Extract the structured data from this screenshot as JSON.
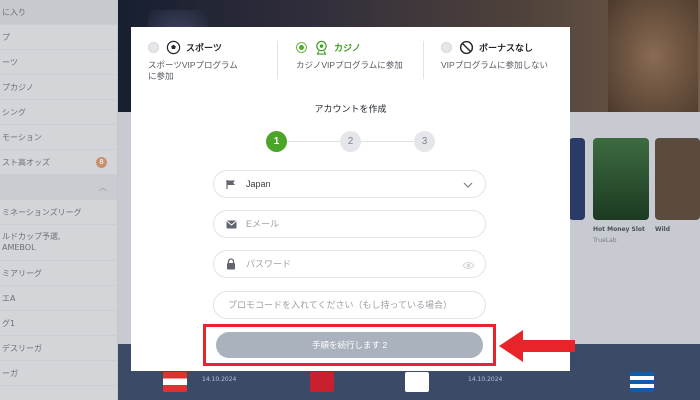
{
  "background": {
    "sidebar_items": [
      {
        "label": "に入り"
      },
      {
        "label": "プ"
      },
      {
        "label": "ーツ"
      },
      {
        "label": "プカジノ"
      },
      {
        "label": "シング"
      },
      {
        "label": "モーション"
      },
      {
        "label": "スト高オッズ",
        "badge": "8"
      },
      {
        "label": ""
      },
      {
        "label": "ミネーションズリーグ"
      },
      {
        "label": "ルドカップ予選,\nAMEBOL"
      },
      {
        "label": "ミアリーグ"
      },
      {
        "label": "エA"
      },
      {
        "label": "グ1"
      },
      {
        "label": "デスリーガ"
      },
      {
        "label": "ーガ"
      }
    ],
    "game_card_labels": {
      "card2_title": "Hot Money Slot",
      "card2_provider": "TrueLab",
      "card3_title": "Wild"
    },
    "match_dates": [
      "14.10.2024",
      "14.10.2024"
    ]
  },
  "modal": {
    "bonus_options": [
      {
        "title": "スポーツ",
        "desc": "スポーツVIPプログラムに参加",
        "icon": "soccer-ball-icon",
        "selected": false
      },
      {
        "title": "カジノ",
        "desc": "カジノVIPプログラムに参加",
        "icon": "roulette-icon",
        "selected": true
      },
      {
        "title": "ボーナスなし",
        "desc": "VIPプログラムに参加しない",
        "icon": "no-entry-icon",
        "selected": false
      }
    ],
    "title": "アカウントを作成",
    "steps": [
      "1",
      "2",
      "3"
    ],
    "active_step": 1,
    "country": {
      "value": "Japan",
      "icon": "flag-icon"
    },
    "email": {
      "placeholder": "Eメール",
      "icon": "envelope-icon"
    },
    "password": {
      "placeholder": "パスワード",
      "icon": "lock-icon"
    },
    "promo": {
      "placeholder": "プロモコードを入れてください（もし持っている場合）"
    },
    "continue_button": "手順を続行します 2"
  },
  "colors": {
    "accent_green": "#4aa528",
    "highlight_red": "#e8242a",
    "button_disabled": "#aab2be"
  }
}
